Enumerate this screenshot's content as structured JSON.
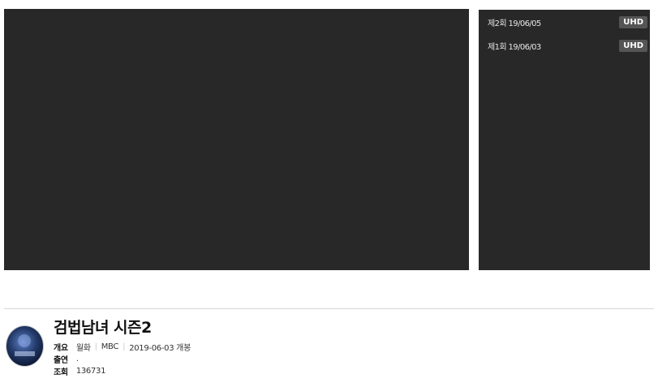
{
  "episodes": [
    {
      "label": "제2회 19/06/05",
      "badge": "UHD"
    },
    {
      "label": "제1회 19/06/03",
      "badge": "UHD"
    }
  ],
  "program": {
    "title": "검법남녀 시즌2",
    "summary_key": "개요",
    "summary_values": [
      "월화",
      "MBC",
      "2019-06-03 개봉"
    ],
    "cast_key": "출연",
    "cast_value": ".",
    "views_key": "조회",
    "views_value": "136731"
  },
  "colors": {
    "player_bg": "#282828",
    "badge_bg": "#555555"
  }
}
